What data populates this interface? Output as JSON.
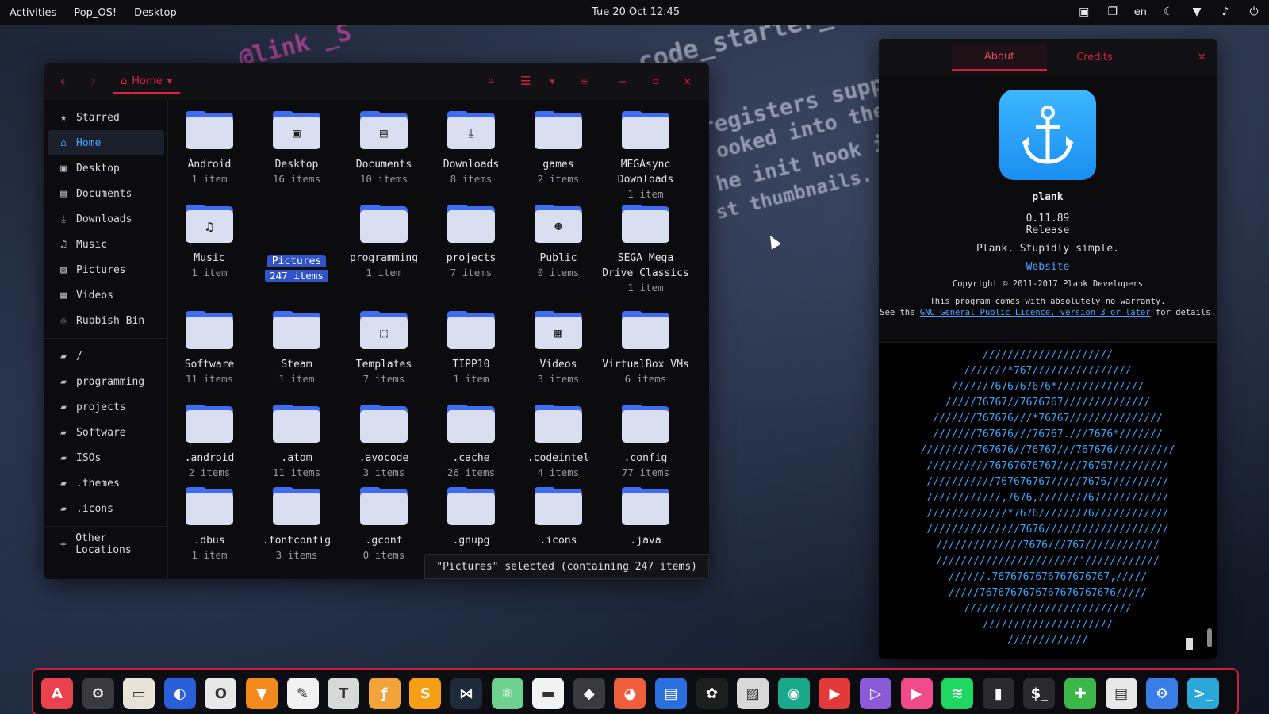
{
  "topbar": {
    "activities": "Activities",
    "app_menu": "Pop_OS!",
    "workspace": "Desktop",
    "clock": "Tue 20 Oct 12:45",
    "lang": "en"
  },
  "file_manager": {
    "location": "Home",
    "sidebar": [
      {
        "label": "Starred",
        "icon": "star-icon",
        "glyph": "★"
      },
      {
        "label": "Home",
        "icon": "home-icon",
        "glyph": "⌂",
        "active": true
      },
      {
        "label": "Desktop",
        "icon": "desktop-icon",
        "glyph": "▣"
      },
      {
        "label": "Documents",
        "icon": "document-icon",
        "glyph": "▤"
      },
      {
        "label": "Downloads",
        "icon": "download-icon",
        "glyph": "⤓"
      },
      {
        "label": "Music",
        "icon": "music-icon",
        "glyph": "♫"
      },
      {
        "label": "Pictures",
        "icon": "pictures-icon",
        "glyph": "▨"
      },
      {
        "label": "Videos",
        "icon": "videos-icon",
        "glyph": "▦"
      },
      {
        "label": "Rubbish Bin",
        "icon": "trash-icon",
        "glyph": "♲"
      }
    ],
    "bookmarks": [
      {
        "label": "/",
        "icon": "folder-icon"
      },
      {
        "label": "programming",
        "icon": "folder-icon"
      },
      {
        "label": "projects",
        "icon": "folder-icon"
      },
      {
        "label": "Software",
        "icon": "folder-icon"
      },
      {
        "label": "ISOs",
        "icon": "folder-icon"
      },
      {
        "label": ".themes",
        "icon": "folder-icon"
      },
      {
        "label": ".icons",
        "icon": "folder-icon"
      }
    ],
    "other_locations": "Other Locations",
    "rows": [
      [
        {
          "name": "Android",
          "count": "1 item"
        },
        {
          "name": "Desktop",
          "count": "16 items",
          "glyph": "▣"
        },
        {
          "name": "Documents",
          "count": "10 items",
          "glyph": "▤"
        },
        {
          "name": "Downloads",
          "count": "8 items",
          "glyph": "⤓"
        },
        {
          "name": "games",
          "count": "2 items"
        },
        {
          "name": "MEGAsync Downloads",
          "count": "1 item"
        }
      ],
      [
        {
          "name": "Music",
          "count": "1 item",
          "glyph": "♫"
        },
        {
          "name": "Pictures",
          "count": "247 items",
          "selected": true
        },
        {
          "name": "programming",
          "count": "1 item"
        },
        {
          "name": "projects",
          "count": "7 items"
        },
        {
          "name": "Public",
          "count": "0 items",
          "glyph": "☻"
        },
        {
          "name": "SEGA Mega Drive Classics",
          "count": "1 item"
        }
      ],
      [
        {
          "name": "Software",
          "count": "11 items"
        },
        {
          "name": "Steam",
          "count": "1 item"
        },
        {
          "name": "Templates",
          "count": "7 items",
          "glyph": "⬚"
        },
        {
          "name": "TIPP10",
          "count": "1 item"
        },
        {
          "name": "Videos",
          "count": "3 items",
          "glyph": "▦"
        },
        {
          "name": "VirtualBox VMs",
          "count": "6 items"
        }
      ],
      [
        {
          "name": ".android",
          "count": "2 items"
        },
        {
          "name": ".atom",
          "count": "11 items"
        },
        {
          "name": ".avocode",
          "count": "3 items"
        },
        {
          "name": ".cache",
          "count": "26 items"
        },
        {
          "name": ".codeintel",
          "count": "4 items"
        },
        {
          "name": ".config",
          "count": "77 items"
        }
      ],
      [
        {
          "name": ".dbus",
          "count": "1 item"
        },
        {
          "name": ".fontconfig",
          "count": "3 items"
        },
        {
          "name": ".gconf",
          "count": "0 items"
        },
        {
          "name": ".gnupg",
          "count": ""
        },
        {
          "name": ".icons",
          "count": ""
        },
        {
          "name": ".java",
          "count": ""
        }
      ]
    ],
    "status": "\"Pictures\" selected (containing 247 items)"
  },
  "about": {
    "tab_about": "About",
    "tab_credits": "Credits",
    "app_name": "plank",
    "version": "0.11.89",
    "release": "Release",
    "tagline": "Plank. Stupidly simple.",
    "website": "Website",
    "copyright": "Copyright © 2011-2017 Plank Developers",
    "warranty_line1": "This program comes with absolutely no warranty.",
    "warranty_pre": "See the",
    "licence_link": "GNU General Public Licence, version 3 or later",
    "warranty_post": "for details.",
    "accent": "#d0203d"
  },
  "terminal_ascii": [
    "/////////////////////",
    "///////*767////////////////",
    "//////7676767676*//////////////",
    "/////76767//7676767//////////////",
    "///////767676///*76767///////////////",
    "///////767676///76767.///7676*///////",
    "/////////767676//76767///767676//////////",
    "//////////76767676767////76767/////////",
    "///////////767676767/////7676//////////",
    "////////////,7676,///////767///////////",
    "/////////////*7676///////76////////////",
    "///////////////7676////////////////////",
    "//////////////7676///767////////////",
    "///////////////////////'////////////",
    "//////.7676767676767676767,/////",
    "/////7676767676767676767676/////",
    "///////////////////////////",
    "/////////////////////",
    "/////////////"
  ],
  "dock": [
    {
      "name": "app-store-icon",
      "bg": "#e9414d",
      "glyph": "A"
    },
    {
      "name": "settings-icon",
      "bg": "#3a3a3e",
      "glyph": "⚙"
    },
    {
      "name": "files-icon",
      "bg": "#e8e4d8",
      "glyph": "▭"
    },
    {
      "name": "firefox-icon",
      "bg": "#2b5fd9",
      "glyph": "◐"
    },
    {
      "name": "opera-icon",
      "bg": "#e8e8e8",
      "glyph": "O"
    },
    {
      "name": "brave-icon",
      "bg": "#f28a1e",
      "glyph": "▼"
    },
    {
      "name": "text-editor-icon",
      "bg": "#f2f2f2",
      "glyph": "✎"
    },
    {
      "name": "typora-icon",
      "bg": "#d8d8d8",
      "glyph": "T"
    },
    {
      "name": "font-manager-icon",
      "bg": "#f2a43a",
      "glyph": "ƒ"
    },
    {
      "name": "sublime-icon",
      "bg": "#f59e16",
      "glyph": "S"
    },
    {
      "name": "vscode-icon",
      "bg": "#1e2a3a",
      "glyph": "⋈"
    },
    {
      "name": "atom-icon",
      "bg": "#6fd18f",
      "glyph": "⚛"
    },
    {
      "name": "messages-icon",
      "bg": "#f2f2f2",
      "glyph": "▬"
    },
    {
      "name": "inkscape-icon",
      "bg": "#3a3a3e",
      "glyph": "◆"
    },
    {
      "name": "gimp-icon",
      "bg": "#ef5e3a",
      "glyph": "◕"
    },
    {
      "name": "writer-icon",
      "bg": "#2a6ee0",
      "glyph": "▤"
    },
    {
      "name": "figma-icon",
      "bg": "#1e1e1e",
      "glyph": "✿"
    },
    {
      "name": "image-viewer-icon",
      "bg": "#d8d8d8",
      "glyph": "▨"
    },
    {
      "name": "screenshot-icon",
      "bg": "#1aa88a",
      "glyph": "◉"
    },
    {
      "name": "video-camera-icon",
      "bg": "#e23a3a",
      "glyph": "▶"
    },
    {
      "name": "media-player-icon",
      "bg": "#8a5ad8",
      "glyph": "▷"
    },
    {
      "name": "kdenlive-icon",
      "bg": "#f04a8a",
      "glyph": "▶"
    },
    {
      "name": "spotify-icon",
      "bg": "#1ed760",
      "glyph": "≋"
    },
    {
      "name": "audio-icon",
      "bg": "#2a2a2e",
      "glyph": "▮"
    },
    {
      "name": "terminal-icon",
      "bg": "#2a2a2e",
      "glyph": "$_"
    },
    {
      "name": "extensions-icon",
      "bg": "#3cb84a",
      "glyph": "✚"
    },
    {
      "name": "layout-icon",
      "bg": "#e8e8e8",
      "glyph": "▤"
    },
    {
      "name": "system-settings-icon",
      "bg": "#3a7ce8",
      "glyph": "⚙"
    },
    {
      "name": "console-icon",
      "bg": "#2aa8d8",
      "glyph": ">_"
    }
  ]
}
